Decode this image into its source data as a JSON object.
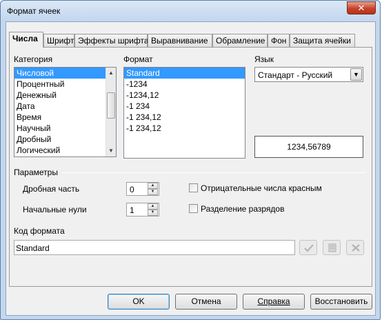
{
  "window": {
    "title": "Формат ячеек",
    "close_glyph": "✕"
  },
  "tabs": [
    {
      "label": "Числа",
      "active": true
    },
    {
      "label": "Шрифт"
    },
    {
      "label": "Эффекты шрифта"
    },
    {
      "label": "Выравнивание"
    },
    {
      "label": "Обрамление"
    },
    {
      "label": "Фон"
    },
    {
      "label": "Защита ячейки"
    }
  ],
  "category": {
    "label": "Категория",
    "items": [
      "Числовой",
      "Процентный",
      "Денежный",
      "Дата",
      "Время",
      "Научный",
      "Дробный",
      "Логический"
    ],
    "selected": "Числовой"
  },
  "format": {
    "label": "Формат",
    "items": [
      "Standard",
      "-1234",
      "-1234,12",
      "-1 234",
      "-1 234,12",
      "-1 234,12"
    ],
    "selected": "Standard"
  },
  "language": {
    "label": "Язык",
    "value": "Стандарт - Русский"
  },
  "preview": {
    "value": "1234,56789"
  },
  "options": {
    "label": "Параметры",
    "decimal_label": "Дробная часть",
    "decimal_value": "0",
    "leading_label": "Начальные нули",
    "leading_value": "1",
    "negative_red_label": "Отрицательные числа красным",
    "negative_red_checked": false,
    "thousands_label": "Разделение разрядов",
    "thousands_checked": false
  },
  "format_code": {
    "label": "Код формата",
    "value": "Standard"
  },
  "icons": {
    "apply": "check-icon",
    "comment": "comment-icon",
    "delete": "delete-icon"
  },
  "buttons": {
    "ok": "OK",
    "cancel": "Отмена",
    "help": "Справка",
    "reset": "Восстановить"
  }
}
